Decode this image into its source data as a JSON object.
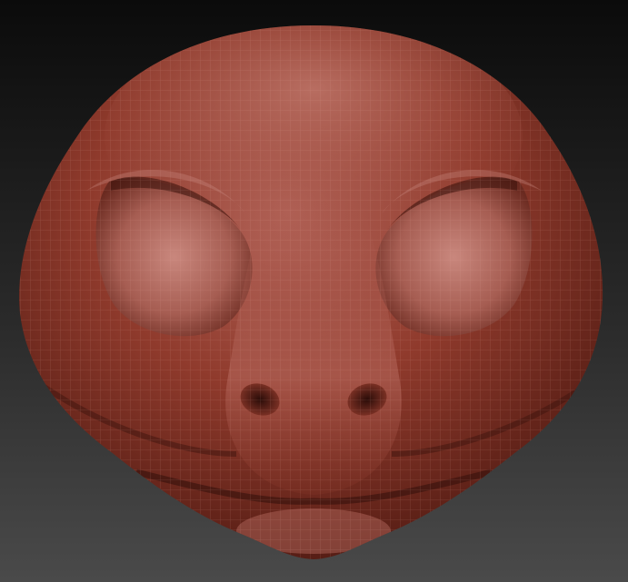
{
  "viewport": {
    "subject": "sculpted-creature-head",
    "background_top": "#0b0b0b",
    "background_bottom": "#4a4a4a",
    "material_base": "#8f3a2c",
    "material_highlight": "#c98a80",
    "material_shadow": "#3d140e",
    "wireframe_color": "#e8b0a6"
  }
}
